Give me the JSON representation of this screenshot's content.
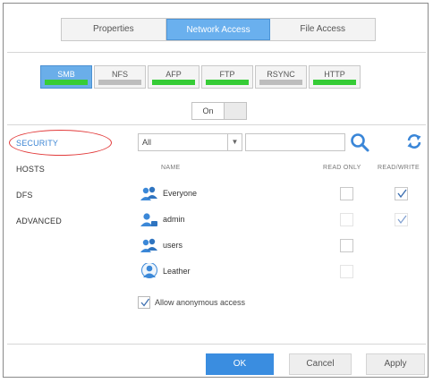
{
  "top_tabs": [
    {
      "label": "Properties"
    },
    {
      "label": "Network Access"
    },
    {
      "label": "File Access"
    }
  ],
  "protocols": [
    {
      "label": "SMB",
      "enabled": true
    },
    {
      "label": "NFS",
      "enabled": false
    },
    {
      "label": "AFP",
      "enabled": true
    },
    {
      "label": "FTP",
      "enabled": true
    },
    {
      "label": "RSYNC",
      "enabled": false
    },
    {
      "label": "HTTP",
      "enabled": true
    }
  ],
  "toggle": {
    "label": "On"
  },
  "sidebar": {
    "items": [
      {
        "label": "SECURITY"
      },
      {
        "label": "HOSTS"
      },
      {
        "label": "DFS"
      },
      {
        "label": "ADVANCED"
      }
    ]
  },
  "filter": {
    "selected": "All",
    "search_placeholder": ""
  },
  "columns": {
    "name": "NAME",
    "read_only": "READ ONLY",
    "read_write": "READ/WRITE"
  },
  "users": [
    {
      "name": "Everyone",
      "read_only": false,
      "read_write": true
    },
    {
      "name": "admin",
      "read_only": false,
      "read_write": true
    },
    {
      "name": "users",
      "read_only": false,
      "read_write": false
    },
    {
      "name": "Leather",
      "read_only": false,
      "read_write": false
    }
  ],
  "anonymous": {
    "label": "Allow anonymous access",
    "checked": true
  },
  "buttons": {
    "ok": "OK",
    "cancel": "Cancel",
    "apply": "Apply"
  },
  "colors": {
    "accent": "#3a8de0",
    "tab_active": "#6ab0ee",
    "enabled_bar": "#36cc36",
    "disabled_bar": "#bdbdbd",
    "highlight": "#e23b3b"
  }
}
